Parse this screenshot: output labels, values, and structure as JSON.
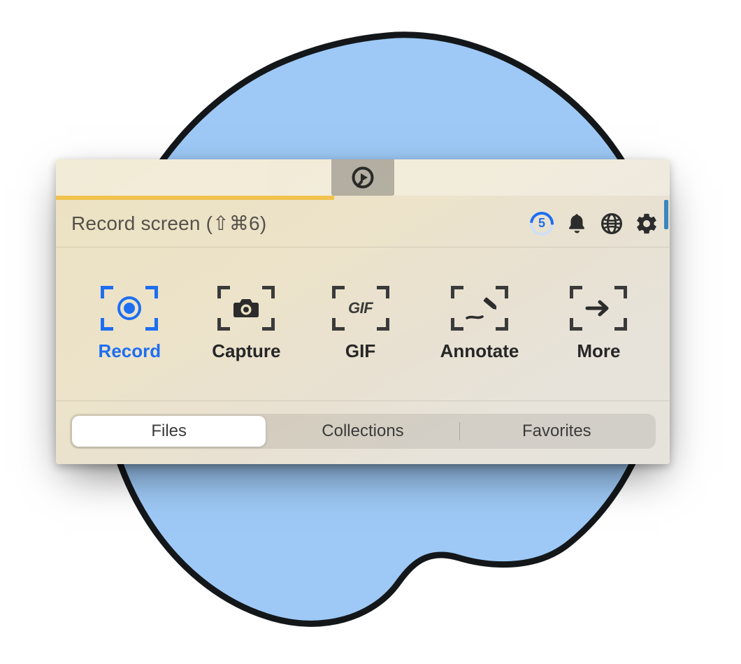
{
  "header": {
    "title": "Record screen (⇧⌘6)",
    "countdown": "5"
  },
  "tools": [
    {
      "label": "Record"
    },
    {
      "label": "Capture"
    },
    {
      "label": "GIF",
      "glyph": "GIF"
    },
    {
      "label": "Annotate"
    },
    {
      "label": "More"
    }
  ],
  "tabs": {
    "files": "Files",
    "collections": "Collections",
    "favorites": "Favorites"
  },
  "colors": {
    "accent": "#1e6ef0"
  }
}
